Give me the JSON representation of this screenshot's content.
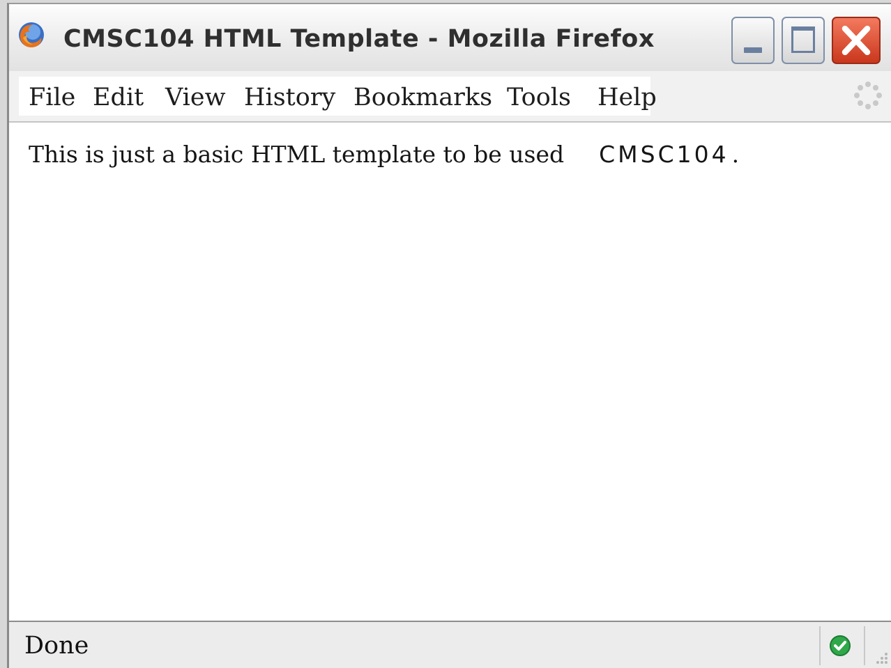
{
  "window": {
    "title": "CMSC104 HTML Template - Mozilla Firefox",
    "app_icon": "firefox-icon",
    "controls": [
      "minimize-icon",
      "maximize-icon",
      "close-icon"
    ]
  },
  "menubar": {
    "items": [
      {
        "label": "File"
      },
      {
        "label": "Edit"
      },
      {
        "label": "View"
      },
      {
        "label": "History"
      },
      {
        "label": "Bookmarks"
      },
      {
        "label": "Tools"
      },
      {
        "label": "Help"
      }
    ],
    "activity_icon": "throbber-icon"
  },
  "content": {
    "text": "This is just a basic HTML template to be used",
    "course": "CMSC104",
    "period": "."
  },
  "statusbar": {
    "status": "Done",
    "security_icon": "check-icon"
  },
  "colors": {
    "close_button": "#d9472a",
    "window_control_glyph": "#6a7fa0",
    "status_ok": "#2fa84a"
  }
}
